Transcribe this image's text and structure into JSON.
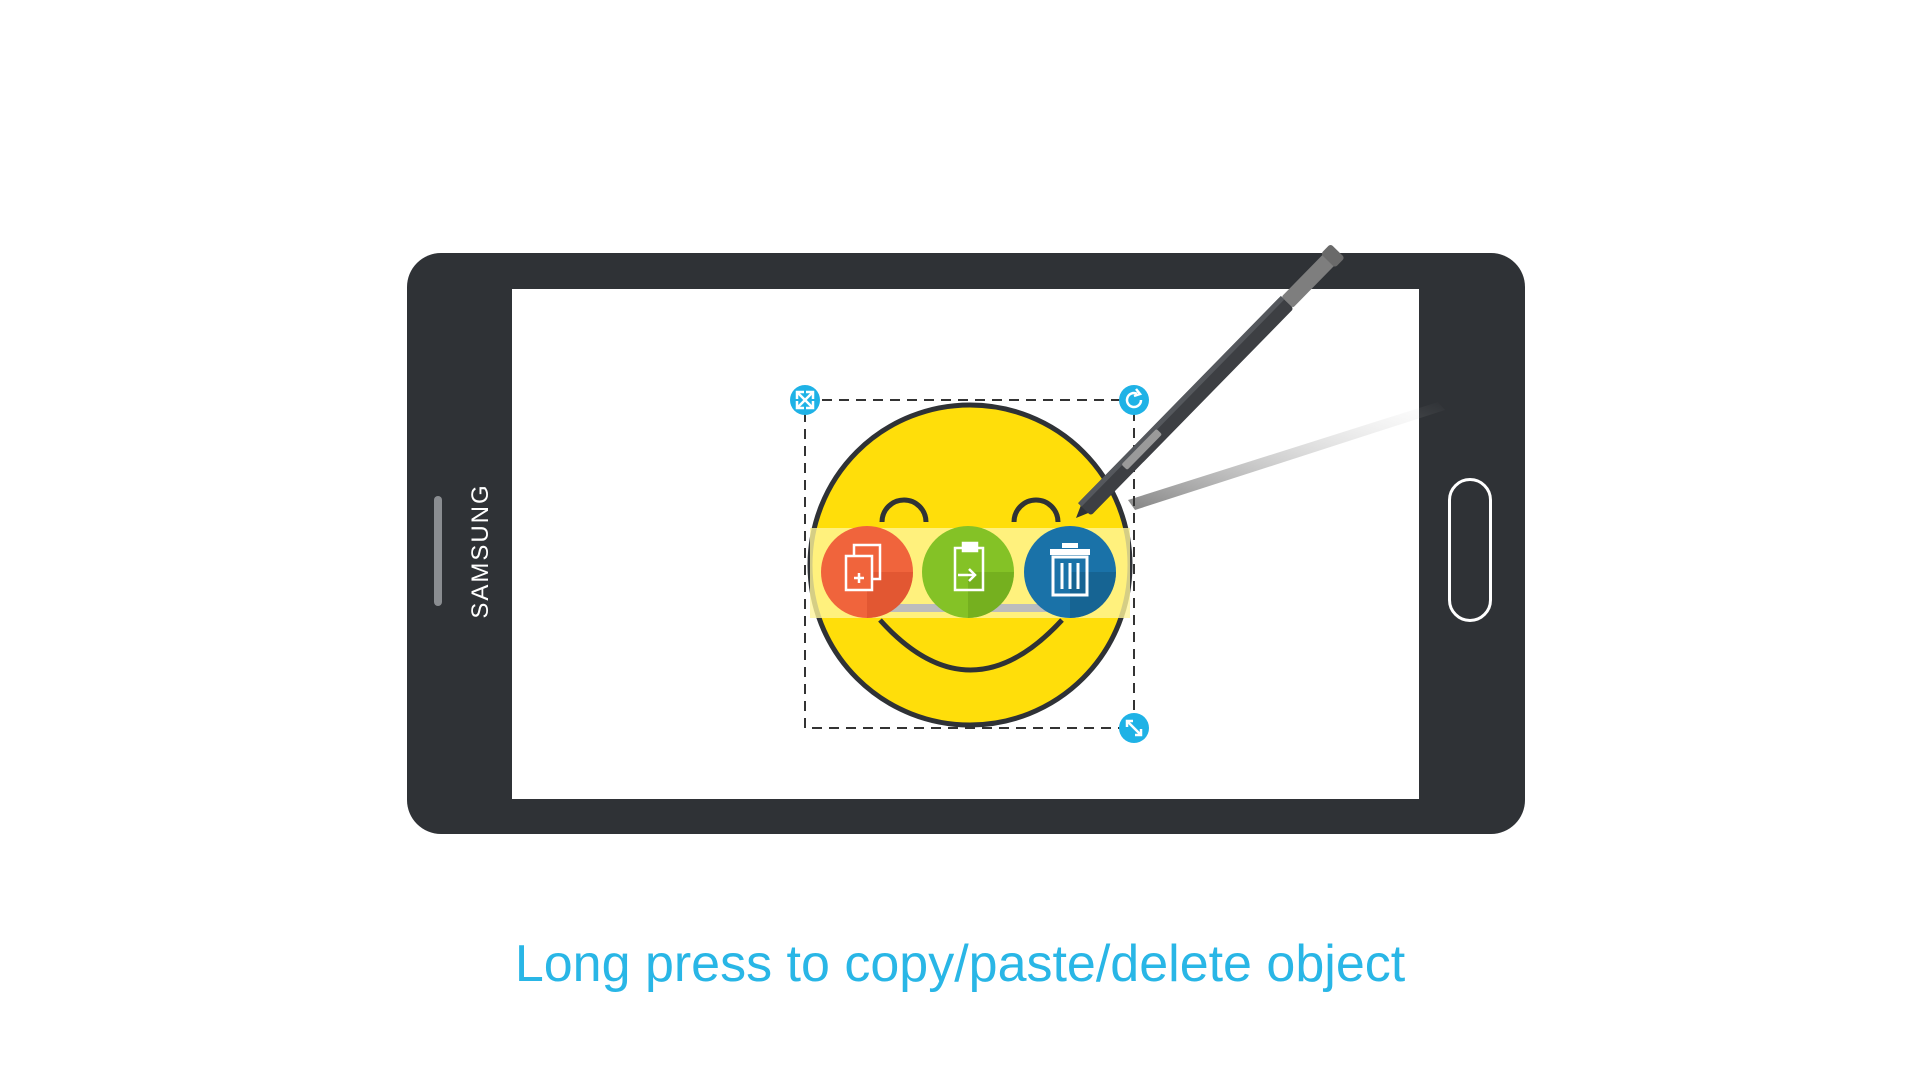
{
  "device": {
    "brand": "SAMSUNG"
  },
  "caption": "Long press to copy/paste/delete object",
  "colors": {
    "phone_body": "#2f3236",
    "smiley_fill": "#ffde0a",
    "handle_blue": "#1fb2e6",
    "copy_orange": "#f0643c",
    "paste_green": "#84c226",
    "delete_blue": "#1a72a8",
    "caption_blue": "#29b6e6"
  },
  "context_menu": {
    "items": [
      {
        "action": "copy",
        "icon": "copy-icon"
      },
      {
        "action": "paste",
        "icon": "paste-icon"
      },
      {
        "action": "delete",
        "icon": "trash-icon"
      }
    ]
  },
  "selection_handles": [
    "expand-icon",
    "rotate-icon",
    "resize-icon"
  ]
}
